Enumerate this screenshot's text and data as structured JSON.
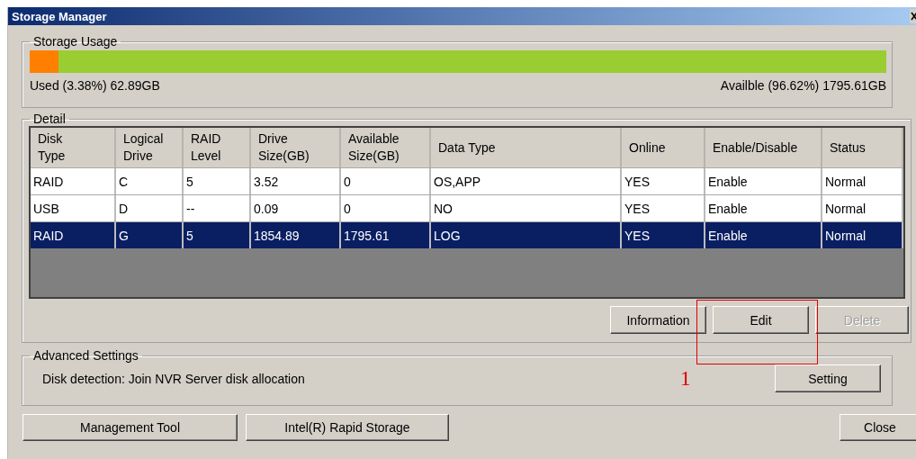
{
  "window": {
    "title": "Storage Manager"
  },
  "storage_usage": {
    "title": "Storage Usage",
    "level": 0.0338,
    "used": "Used (3.38%) 62.89GB",
    "available": "Availble (96.62%) 1795.61GB"
  },
  "detail": {
    "title": "Detail",
    "columns": [
      "Disk\nType",
      "Logical\nDrive",
      "RAID\nLevel",
      "Drive\nSize(GB)",
      "Available\nSize(GB)",
      "Data Type",
      "Online",
      "Enable/Disable",
      "Status"
    ],
    "rows": [
      {
        "cells": [
          "RAID",
          "C",
          "5",
          "3.52",
          "0",
          "OS,APP",
          "YES",
          "Enable",
          "Normal"
        ],
        "selected": false
      },
      {
        "cells": [
          "USB",
          "D",
          "--",
          "0.09",
          "0",
          "NO",
          "YES",
          "Enable",
          "Normal"
        ],
        "selected": false
      },
      {
        "cells": [
          "RAID",
          "G",
          "5",
          "1854.89",
          "1795.61",
          "LOG",
          "YES",
          "Enable",
          "Normal"
        ],
        "selected": true
      }
    ],
    "buttons": [
      {
        "label": "Information",
        "disabled": false
      },
      {
        "label": "Edit",
        "disabled": false
      },
      {
        "label": "Delete",
        "disabled": true
      }
    ]
  },
  "advanced_settings": {
    "title": "Advanced Settings",
    "text": "Disk detection: Join NVR Server disk allocation",
    "button": "Setting"
  },
  "annotation": {
    "label": "1"
  },
  "footer_buttons": [
    "Management Tool",
    "Intel(R) Rapid Storage"
  ],
  "close_button": "Close"
}
